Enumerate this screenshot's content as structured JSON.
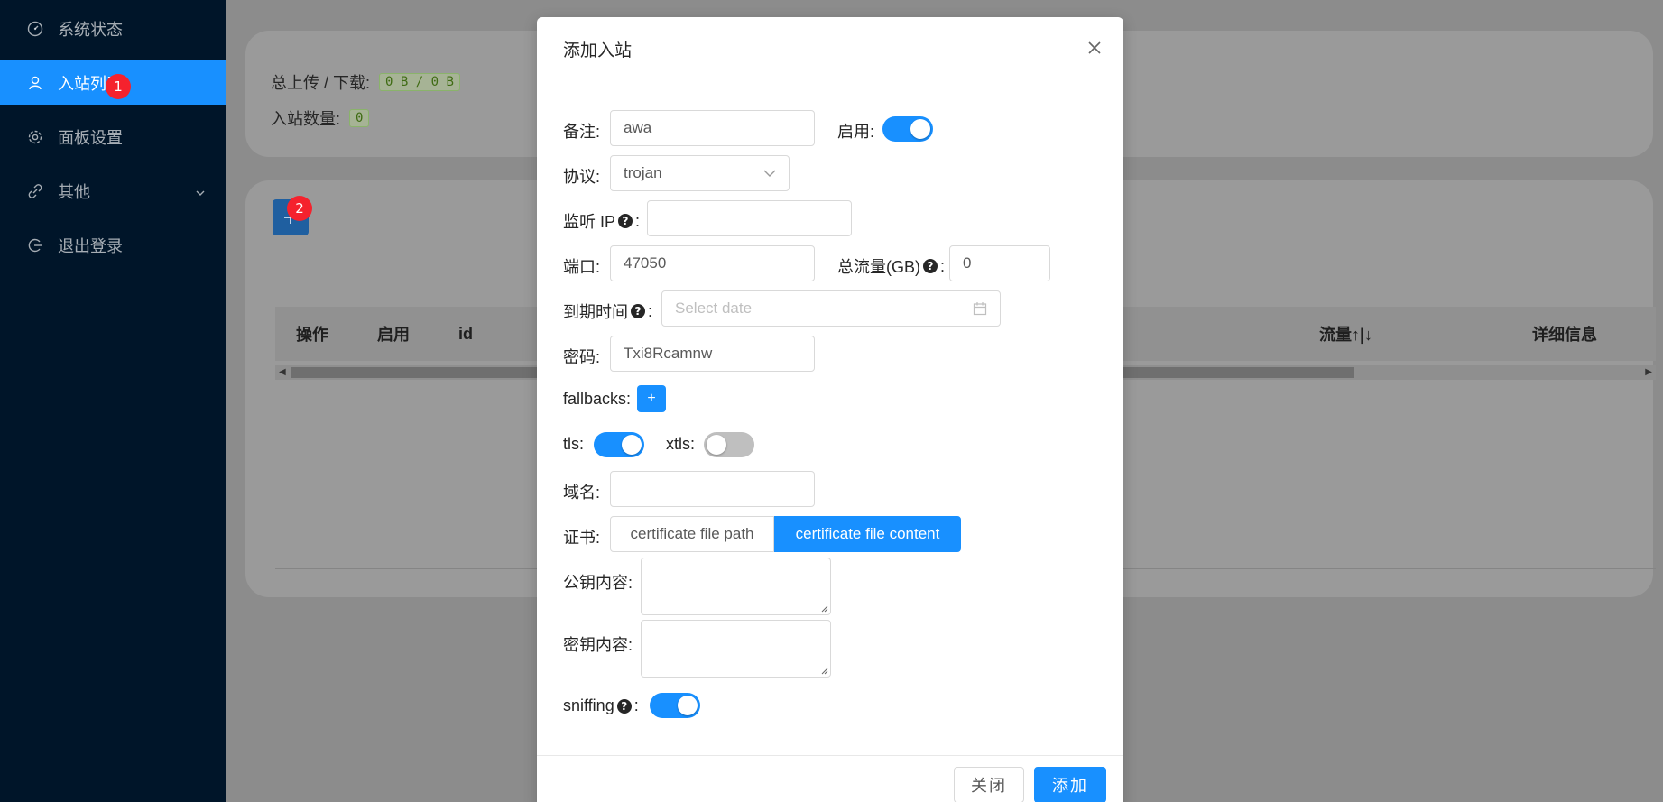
{
  "sidebar": {
    "items": [
      {
        "label": "系统状态",
        "icon": "dashboard-icon"
      },
      {
        "label": "入站列表",
        "icon": "user-icon"
      },
      {
        "label": "面板设置",
        "icon": "gear-icon"
      },
      {
        "label": "其他",
        "icon": "link-icon"
      },
      {
        "label": "退出登录",
        "icon": "logout-icon"
      }
    ],
    "markers": [
      "1",
      "2"
    ]
  },
  "overview": {
    "traffic_label": "总上传 / 下载:",
    "traffic_value": "0 B / 0 B",
    "count_label": "入站数量:",
    "count_value": "0"
  },
  "table": {
    "columns": [
      "操作",
      "启用",
      "id",
      "流量↑|↓",
      "详细信息"
    ]
  },
  "modal": {
    "title": "添加入站",
    "fields": {
      "remark_label": "备注:",
      "remark_value": "awa",
      "enable_label": "启用:",
      "protocol_label": "协议:",
      "protocol_value": "trojan",
      "listen_ip_label": "监听 IP",
      "port_label": "端口:",
      "port_value": "47050",
      "total_traffic_label": "总流量(GB)",
      "total_traffic_value": "0",
      "expiry_label": "到期时间",
      "expiry_placeholder": "Select date",
      "password_label": "密码:",
      "password_value": "Txi8Rcamnw",
      "fallbacks_label": "fallbacks:",
      "fallbacks_add": "+",
      "tls_label": "tls:",
      "xtls_label": "xtls:",
      "domain_label": "域名:",
      "cert_label": "证书:",
      "cert_options": [
        "certificate file path",
        "certificate file content"
      ],
      "public_key_label": "公钥内容:",
      "private_key_label": "密钥内容:",
      "sniffing_label": "sniffing"
    },
    "colon": ":",
    "help_glyph": "?",
    "close_button": "关闭",
    "add_button": "添加"
  },
  "colors": {
    "primary": "#1890ff",
    "sidebar_bg": "#001529",
    "marker": "#f5222d"
  }
}
